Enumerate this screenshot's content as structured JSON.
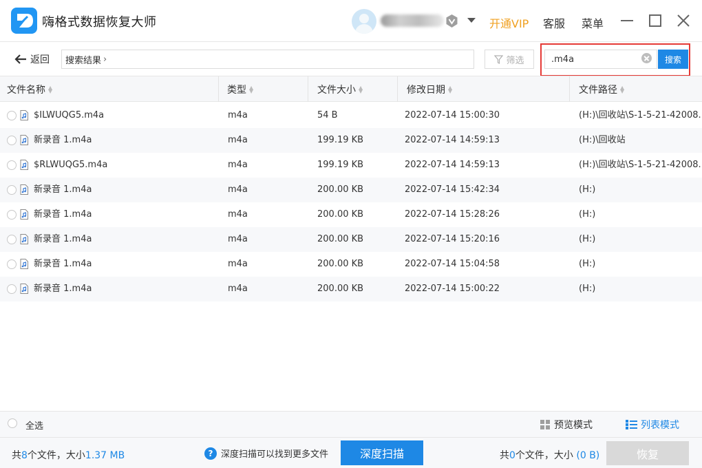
{
  "app": {
    "title": "嗨格式数据恢复大师",
    "logo_icon": "app-logo-icon",
    "vip_label": "开通VIP",
    "service_label": "客服",
    "menu_label": "菜单"
  },
  "toolbar": {
    "back_label": "返回",
    "breadcrumb": "搜索结果",
    "filter_label": "筛选",
    "search_value": ".m4a",
    "search_button": "搜索"
  },
  "table": {
    "columns": [
      "文件名称",
      "类型",
      "文件大小",
      "修改日期",
      "文件路径"
    ],
    "rows": [
      {
        "name": "$ILWUQG5.m4a",
        "type": "m4a",
        "size": "54 B",
        "date": "2022-07-14 15:00:30",
        "path": "(H:)\\回收站\\S-1-5-21-42008..."
      },
      {
        "name": "新录音 1.m4a",
        "type": "m4a",
        "size": "199.19 KB",
        "date": "2022-07-14 14:59:13",
        "path": "(H:)\\回收站"
      },
      {
        "name": "$RLWUQG5.m4a",
        "type": "m4a",
        "size": "199.19 KB",
        "date": "2022-07-14 14:59:13",
        "path": "(H:)\\回收站\\S-1-5-21-42008..."
      },
      {
        "name": "新录音 1.m4a",
        "type": "m4a",
        "size": "200.00 KB",
        "date": "2022-07-14 15:42:34",
        "path": "(H:)"
      },
      {
        "name": "新录音 1.m4a",
        "type": "m4a",
        "size": "200.00 KB",
        "date": "2022-07-14 15:28:26",
        "path": "(H:)"
      },
      {
        "name": "新录音 1.m4a",
        "type": "m4a",
        "size": "200.00 KB",
        "date": "2022-07-14 15:20:16",
        "path": "(H:)"
      },
      {
        "name": "新录音 1.m4a",
        "type": "m4a",
        "size": "200.00 KB",
        "date": "2022-07-14 15:04:58",
        "path": "(H:)"
      },
      {
        "name": "新录音 1.m4a",
        "type": "m4a",
        "size": "200.00 KB",
        "date": "2022-07-14 15:00:22",
        "path": "(H:)"
      }
    ]
  },
  "selectbar": {
    "select_all": "全选",
    "preview_mode": "预览模式",
    "list_mode": "列表模式"
  },
  "status": {
    "total_prefix": "共",
    "total_count": "8",
    "total_mid": "个文件，大小",
    "total_size": "1.37 MB",
    "hint": "深度扫描可以找到更多文件",
    "deep_scan": "深度扫描",
    "selected_prefix": "共",
    "selected_count": "0",
    "selected_mid": "个文件，大小",
    "selected_size": "(0 B)",
    "recover": "恢复"
  },
  "colors": {
    "accent": "#1e88e5",
    "vip": "#f0a020",
    "highlight": "#e53935"
  }
}
